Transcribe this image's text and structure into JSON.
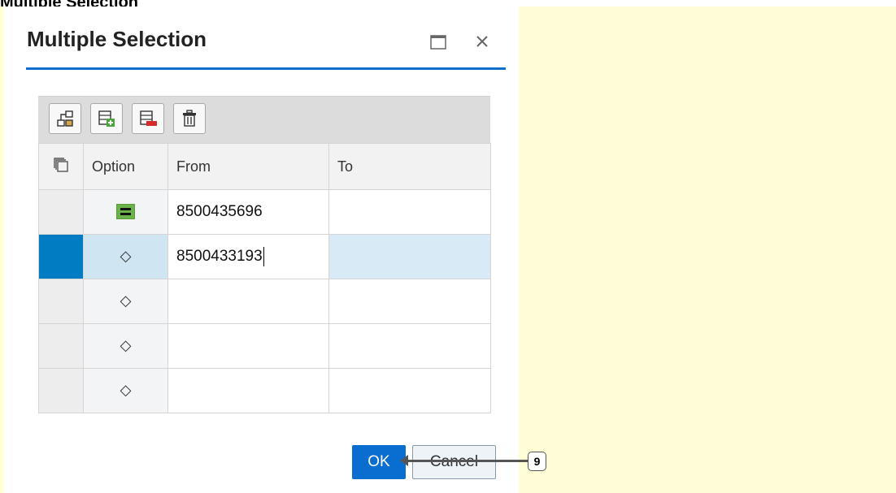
{
  "page": {
    "heading": "Multiple Selection"
  },
  "dialog": {
    "title": "Multiple Selection",
    "toolbar": {
      "buttons": [
        {
          "icon": "hierarchy-icon"
        },
        {
          "icon": "insert-row-icon"
        },
        {
          "icon": "delete-row-icon"
        },
        {
          "icon": "trash-icon"
        }
      ]
    },
    "table": {
      "headers": {
        "option": "Option",
        "from": "From",
        "to": "To"
      },
      "rows": [
        {
          "option_icon": "equals-icon",
          "from": "8500435696",
          "to": "",
          "active": false
        },
        {
          "option_icon": "diamond-icon",
          "from": "8500433193",
          "to": "",
          "active": true
        },
        {
          "option_icon": "diamond-icon",
          "from": "",
          "to": "",
          "active": false
        },
        {
          "option_icon": "diamond-icon",
          "from": "",
          "to": "",
          "active": false
        },
        {
          "option_icon": "diamond-icon",
          "from": "",
          "to": "",
          "active": false
        }
      ]
    },
    "footer": {
      "ok_label": "OK",
      "cancel_label": "Cancel"
    }
  },
  "callout": {
    "number": "9"
  },
  "colors": {
    "accent": "#0a6ed1",
    "note_background": "#fffed7",
    "equals_green": "#6cb24a",
    "active_row": "#007cc3"
  }
}
